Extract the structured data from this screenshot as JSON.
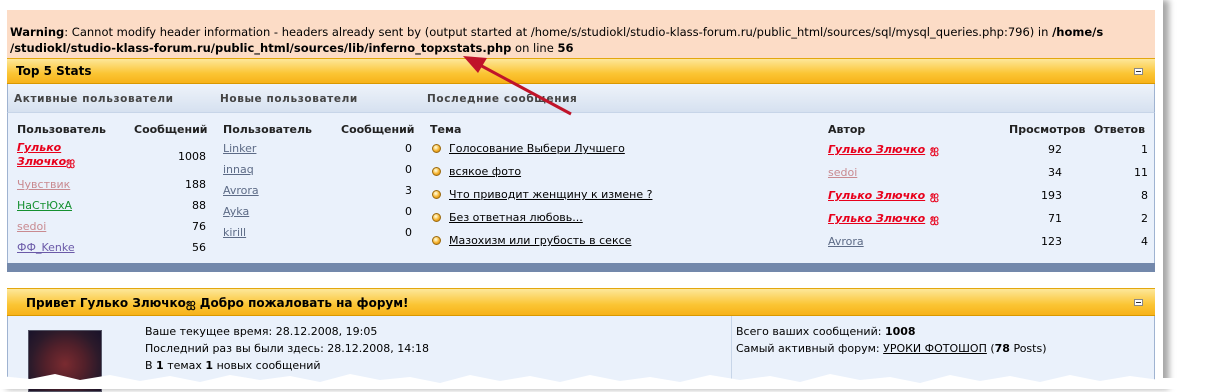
{
  "warning": {
    "label": "Warning",
    "text1": ": Cannot modify header information - headers already sent by (output started at /home/s/studiokl/studio-klass-forum.ru/public_html/sources/sql/mysql_queries.php:796) in ",
    "path": "/home/s/studiokl/studio-klass-forum.ru/public_html/sources/lib/inferno_topxstats.php",
    "path_line1": "/home/s",
    "path_line2": "/studiokl/studio-klass-forum.ru/public_html/sources/lib/inferno_topxstats.php",
    "on_line": " on line ",
    "line_no": "56"
  },
  "stats": {
    "title": "Top 5 Stats",
    "sections": {
      "active": "Активные пользователи",
      "new": "Новые пользователи",
      "posts": "Последние сообщения"
    },
    "headers": {
      "user": "Пользователь",
      "messages": "Сообщений",
      "user2": "Пользователь",
      "messages2": "Сообщений",
      "topic": "Тема",
      "author": "Автор",
      "views": "Просмотров",
      "replies": "Ответов"
    },
    "active_users": [
      {
        "name_line1": "Гулько",
        "name_line2": "Злючко",
        "count": "1008"
      },
      {
        "name": "Чувствик",
        "count": "188"
      },
      {
        "name": "НаСтЮхА",
        "count": "88"
      },
      {
        "name": "sedoi",
        "count": "76"
      },
      {
        "name": "ФФ_Kenke",
        "count": "56"
      }
    ],
    "new_users": [
      {
        "name": "Linker",
        "count": "0"
      },
      {
        "name": "innaq",
        "count": "0"
      },
      {
        "name": "Avrora",
        "count": "3"
      },
      {
        "name": "Ayka",
        "count": "0"
      },
      {
        "name": "kirill",
        "count": "0"
      }
    ],
    "topics": [
      {
        "title": "Голосование Выбери Лучшего",
        "author": "Гулько Злючко",
        "views": "92",
        "replies": "1"
      },
      {
        "title": "всякое фото",
        "author": "sedoi",
        "views": "34",
        "replies": "11"
      },
      {
        "title": "Что приводит женщину к измене ?",
        "author": "Гулько Злючко",
        "views": "193",
        "replies": "8"
      },
      {
        "title": "Без ответная любовь...",
        "author": "Гулько Злючко",
        "views": "71",
        "replies": "2"
      },
      {
        "title": "Мазохизм или грубость в сексе",
        "author": "Avrora",
        "views": "123",
        "replies": "4"
      }
    ]
  },
  "welcome": {
    "title": "Привет Гулько Злючко",
    "title_suffix": " Добро пожаловать на форум!",
    "current_time_label": "Ваше текущее время: ",
    "current_time": "28.12.2008, 19:05",
    "last_visit_label": "Последний раз вы были здесь: ",
    "last_visit": "28.12.2008, 14:18",
    "new_in_prefix": "В ",
    "new_topics": "1",
    "new_in_mid": " темах ",
    "new_posts": "1",
    "new_in_suffix": " новых сообщений",
    "total_posts_label": "Всего ваших сообщений: ",
    "total_posts": "1008",
    "active_forum_label": "Самый активный форум: ",
    "active_forum": "УРОКИ ФОТОШОП",
    "active_forum_posts_pre": " (",
    "active_forum_posts": "78",
    "active_forum_posts_post": " Posts)"
  },
  "colors": {
    "warning_bg": "#fcdcc6",
    "header_yellow": "#fbc534",
    "panel_blue": "#eaf1fb",
    "footer_blue": "#7388ab",
    "arrow": "#c0142a",
    "admin_red": "#e8001b"
  }
}
